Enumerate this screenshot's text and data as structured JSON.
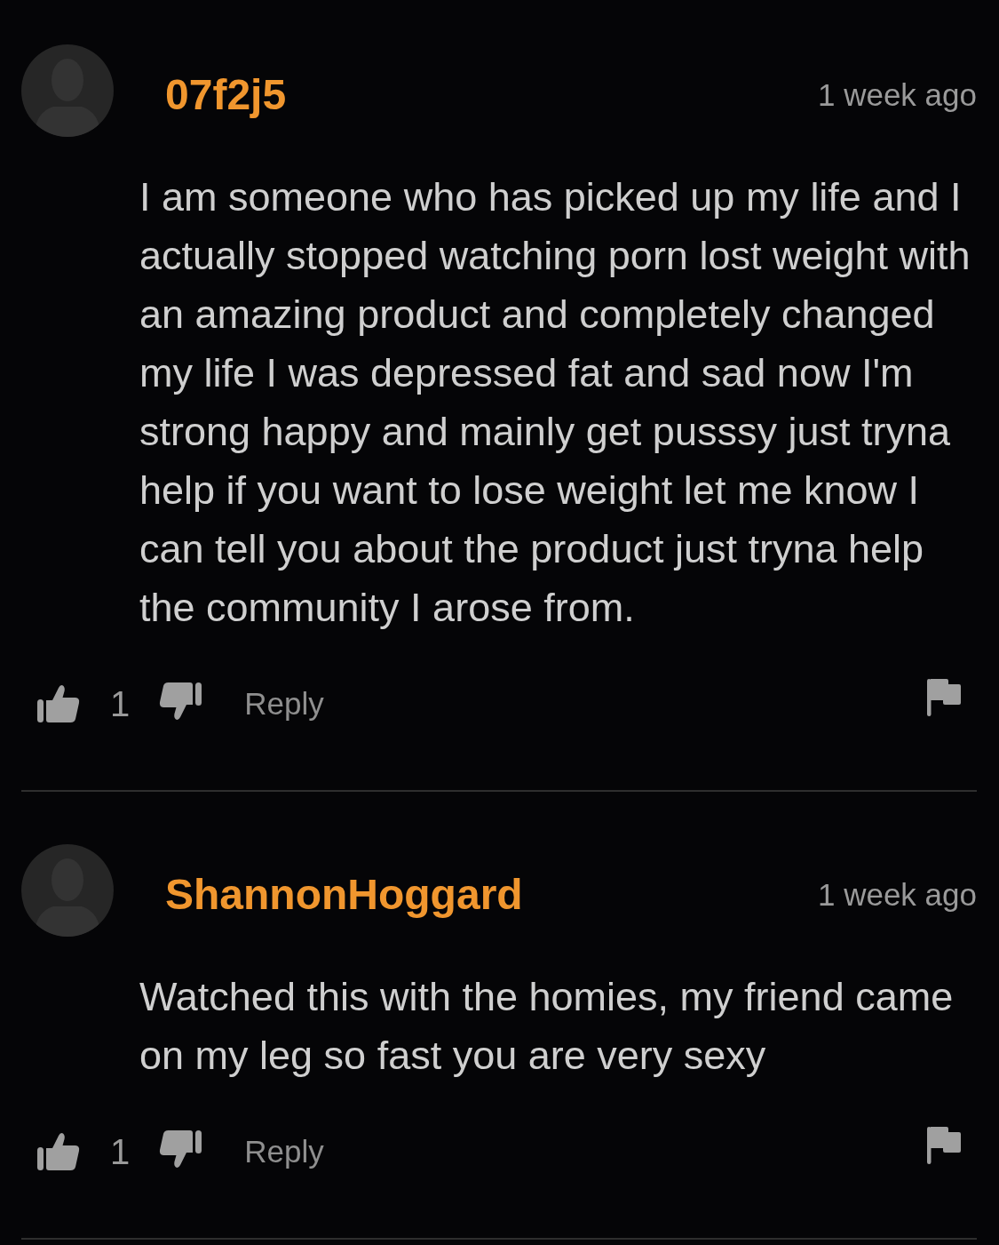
{
  "comments": [
    {
      "username": "07f2j5",
      "time": "1 week ago",
      "text": "I am someone who has picked up my life and I actually stopped watching porn lost weight with an amazing product and completely changed my life I was depressed fat and sad now I'm strong happy and mainly get pusssy just tryna help if you want to lose weight let me know I can tell you about the product just tryna help the community I arose from.",
      "likes": "1",
      "reply": "Reply"
    },
    {
      "username": "ShannonHoggard",
      "time": "1 week ago",
      "text": "Watched this with the homies, my friend came on my leg so fast you are very sexy",
      "likes": "1",
      "reply": "Reply"
    }
  ]
}
